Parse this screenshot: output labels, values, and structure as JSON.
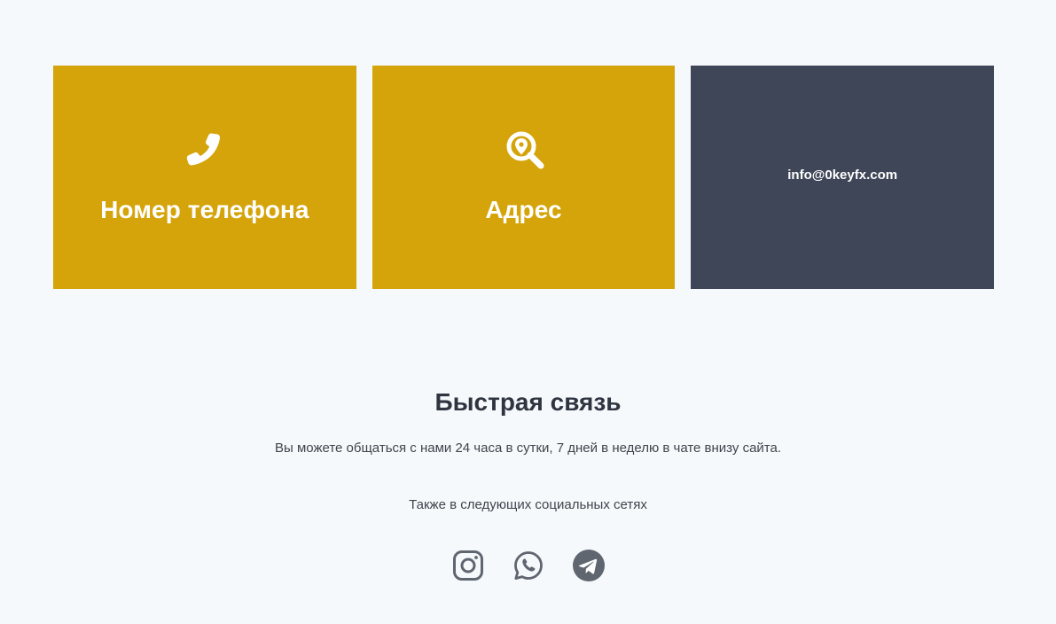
{
  "contact_cards": [
    {
      "label": "Номер телефона",
      "icon": "phone-icon",
      "color": "#d4a40a"
    },
    {
      "label": "Адрес",
      "icon": "location-search-icon",
      "color": "#d4a40a"
    },
    {
      "label": "info@0keyfx.com",
      "color": "#3f4657"
    }
  ],
  "quick_contact": {
    "title": "Быстрая связь",
    "description": "Вы можете общаться с нами 24 часа в сутки, 7 дней в неделю в чате внизу сайта.",
    "social_text": "Также в следующих социальных сетях"
  },
  "socials": [
    {
      "name": "instagram-icon"
    },
    {
      "name": "whatsapp-icon"
    },
    {
      "name": "telegram-icon"
    }
  ],
  "colors": {
    "background": "#f6f9fc",
    "accent": "#d4a40a",
    "dark": "#3f4657",
    "icon_gray": "#5f6670"
  }
}
